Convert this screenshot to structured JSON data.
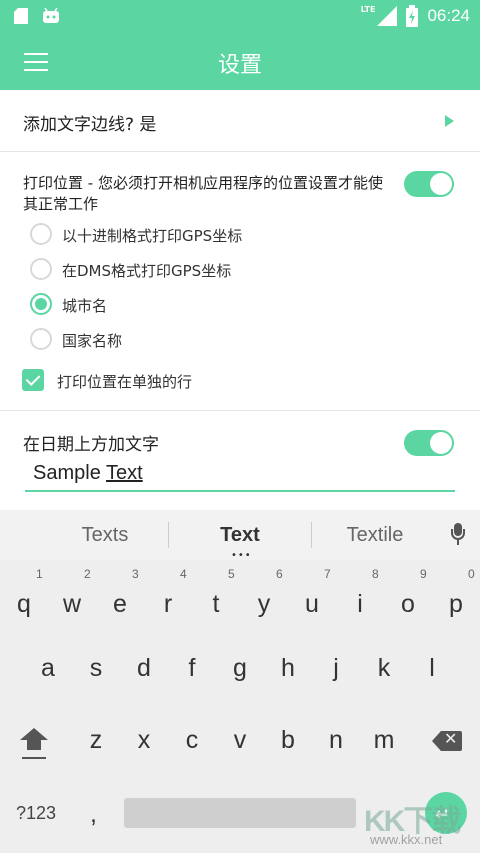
{
  "status_bar": {
    "network": "LTE",
    "time": "06:24"
  },
  "app_bar": {
    "title": "设置"
  },
  "settings": {
    "border_row": {
      "label": "添加文字边线? 是"
    },
    "print_location": {
      "description": "打印位置 - 您必须打开相机应用程序的位置设置才能使其正常工作",
      "enabled": true,
      "options": [
        {
          "label": "以十进制格式打印GPS坐标",
          "selected": false
        },
        {
          "label": "在DMS格式打印GPS坐标",
          "selected": false
        },
        {
          "label": "城市名",
          "selected": true
        },
        {
          "label": "国家名称",
          "selected": false
        }
      ],
      "separate_line": {
        "label": "打印位置在单独的行",
        "checked": true
      }
    },
    "text_above_date": {
      "label": "在日期上方加文字",
      "enabled": true,
      "value_prefix": "Sample ",
      "value_composing": "Text"
    }
  },
  "keyboard": {
    "suggestions": [
      "Texts",
      "Text",
      "Textile"
    ],
    "row1": [
      {
        "key": "q",
        "hint": "1"
      },
      {
        "key": "w",
        "hint": "2"
      },
      {
        "key": "e",
        "hint": "3"
      },
      {
        "key": "r",
        "hint": "4"
      },
      {
        "key": "t",
        "hint": "5"
      },
      {
        "key": "y",
        "hint": "6"
      },
      {
        "key": "u",
        "hint": "7"
      },
      {
        "key": "i",
        "hint": "8"
      },
      {
        "key": "o",
        "hint": "9"
      },
      {
        "key": "p",
        "hint": "0"
      }
    ],
    "row2": [
      "a",
      "s",
      "d",
      "f",
      "g",
      "h",
      "j",
      "k",
      "l"
    ],
    "row3": [
      "z",
      "x",
      "c",
      "v",
      "b",
      "n",
      "m"
    ],
    "symbols_label": "?123",
    "comma": ","
  },
  "watermark": {
    "logo": "KK下载",
    "url": "www.kkx.net"
  }
}
